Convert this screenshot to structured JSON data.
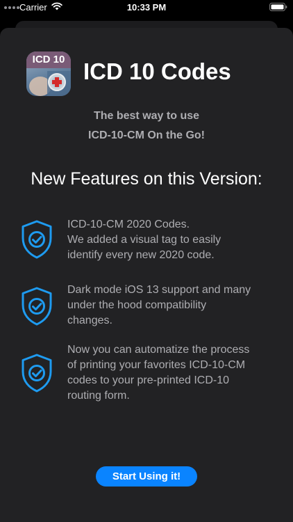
{
  "status_bar": {
    "carrier": "Carrier",
    "time": "10:33 PM",
    "icons": [
      "signal-dots",
      "wifi-icon",
      "battery-icon"
    ]
  },
  "app": {
    "icon_label": "ICD 10",
    "title": "ICD 10 Codes"
  },
  "tagline": {
    "line1": "The best way to use",
    "line2": "ICD-10-CM On the Go!"
  },
  "features_heading": "New Features on this Version:",
  "features": [
    {
      "icon": "shield-check-icon",
      "lines": [
        "ICD-10-CM 2020 Codes.",
        "We added a visual tag to easily",
        "identify every new 2020 code."
      ]
    },
    {
      "icon": "shield-check-icon",
      "lines": [
        "Dark mode iOS 13 support and many",
        "under the hood compatibility",
        "changes."
      ]
    },
    {
      "icon": "shield-check-icon",
      "lines": [
        "Now you can automatize the process",
        "of printing your favorites ICD-10-CM",
        "codes to your pre-printed  ICD-10",
        "routing form."
      ]
    }
  ],
  "start_button_label": "Start Using it!",
  "colors": {
    "accent": "#0a84ff",
    "sheet_background": "#222224",
    "shield_blue": "#1e9bf0"
  }
}
